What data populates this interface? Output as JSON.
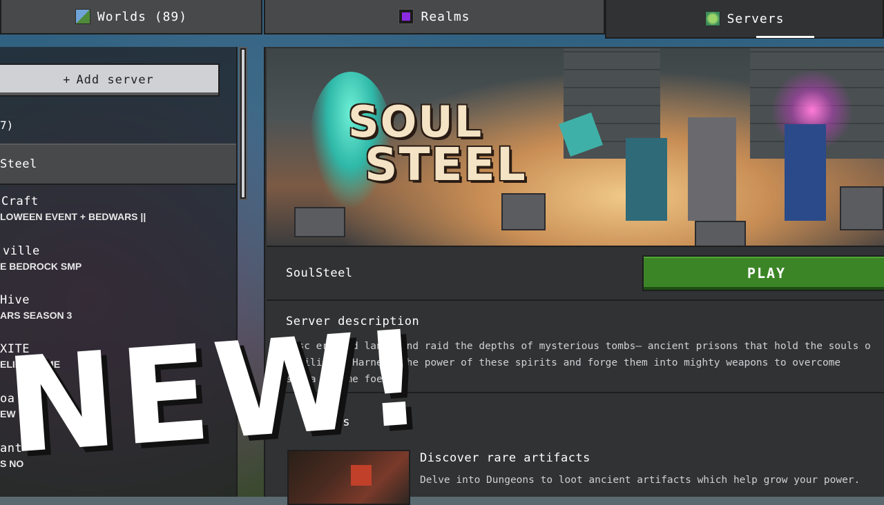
{
  "tabs": {
    "worlds": {
      "label": "Worlds (89)",
      "icon": "world-icon"
    },
    "realms": {
      "label": "Realms",
      "icon": "realm-icon"
    },
    "servers": {
      "label": "Servers",
      "icon": "server-globe-icon",
      "selected": true
    }
  },
  "sidebar": {
    "add_server_label": "Add server",
    "add_server_icon": "plus-icon",
    "count_label": "7)",
    "servers": [
      {
        "name": "Steel",
        "description": "",
        "selected": true
      },
      {
        "name": "Craft",
        "description": "LOWEEN EVENT + BEDWARS ||"
      },
      {
        "name": "ville",
        "description": "E BEDROCK SMP"
      },
      {
        "name": "Hive",
        "description": "ARS SEASON 3"
      },
      {
        "name": "XITE",
        "description": "ELIKE GAME"
      },
      {
        "name": "oa",
        "description": "EW"
      },
      {
        "name": "ant",
        "description": "S NO"
      }
    ]
  },
  "detail": {
    "banner_logo_line1": "SOUL",
    "banner_logo_line2": "STEEL",
    "server_name": "SoulSteel",
    "play_label": "PLAY",
    "description_heading": "Server description",
    "description_lines": [
      "Disc   er      ound lands and raid the depths of mysterious tombs— ancient prisons that hold the souls o",
      "l   wilis   s. Harness the power of these spirits and forge them into mighty weapons to overcome",
      "s       e a   arsome foes."
    ],
    "features_heading": "es",
    "feature": {
      "title": "Discover rare artifacts",
      "description": "Delve into Dungeons to loot ancient artifacts which help grow your power."
    }
  },
  "overlay_text": "NEW!",
  "colors": {
    "play_green": "#3c8527",
    "panel_dark": "#313233",
    "tab_gray": "#48494a",
    "button_light": "#d0d1d4"
  }
}
